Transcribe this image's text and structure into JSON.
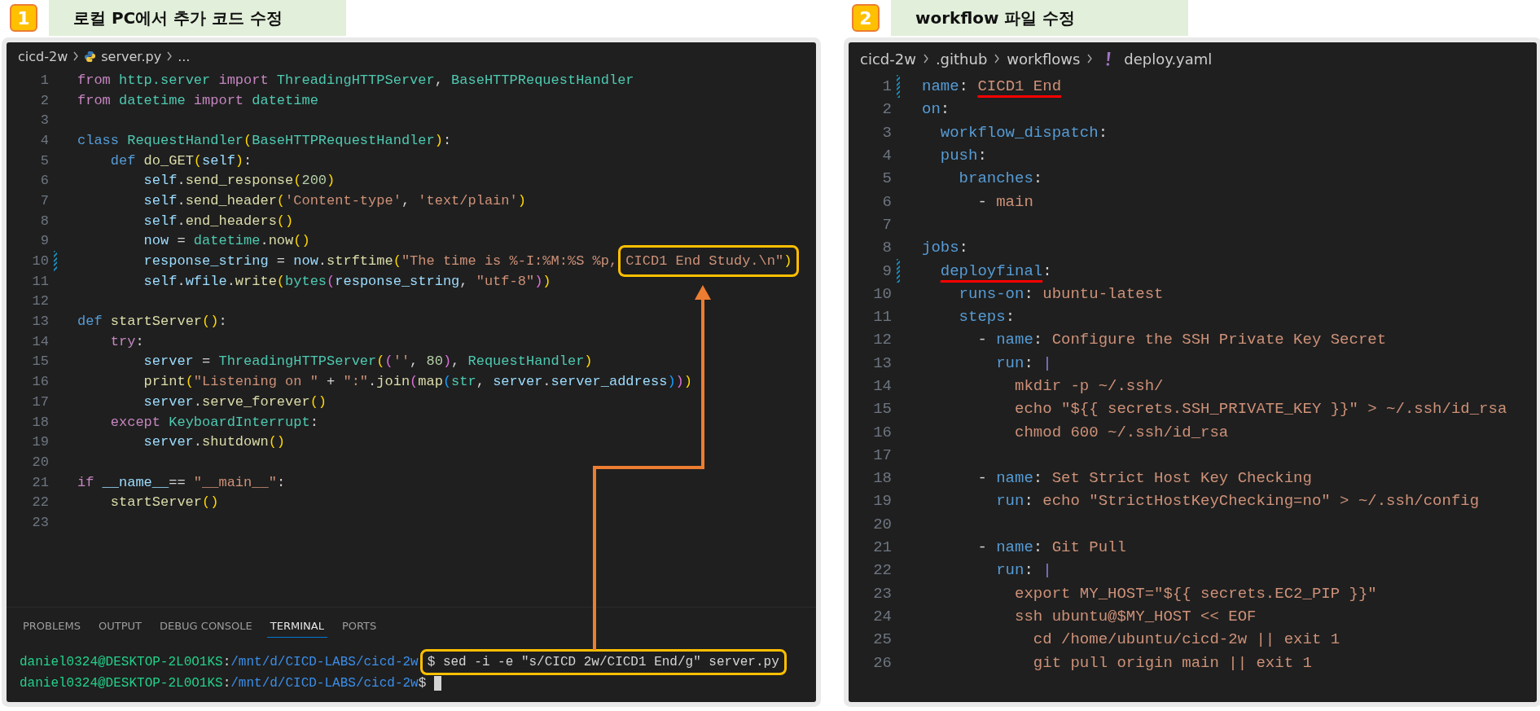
{
  "panels": [
    {
      "kind": "python",
      "step": "1",
      "title": "로컬 PC에서 추가 코드 수정",
      "arrow": true,
      "breadcrumbs": [
        {
          "text": "cicd-2w",
          "kind": "folder"
        },
        {
          "text": "server.py",
          "kind": "python-file"
        },
        {
          "text": "...",
          "kind": "more"
        }
      ],
      "lines": [
        {
          "n": "1",
          "modified": false,
          "tokens": [
            {
              "text": "from",
              "kind": "control"
            },
            {
              "text": " http.server ",
              "kind": "type"
            },
            {
              "text": "import",
              "kind": "control"
            },
            {
              "text": " ThreadingHTTPServer",
              "kind": "type"
            },
            {
              "text": ", ",
              "kind": "plain"
            },
            {
              "text": "BaseHTTPRequestHandler",
              "kind": "type"
            }
          ]
        },
        {
          "n": "2",
          "modified": false,
          "tokens": [
            {
              "text": "from",
              "kind": "control"
            },
            {
              "text": " datetime ",
              "kind": "type"
            },
            {
              "text": "import",
              "kind": "control"
            },
            {
              "text": " datetime",
              "kind": "type"
            }
          ]
        },
        {
          "n": "3",
          "modified": false
        },
        {
          "n": "4",
          "modified": false,
          "tokens": [
            {
              "text": "class",
              "kind": "keyword"
            },
            {
              "text": " RequestHandler",
              "kind": "type"
            },
            {
              "text": "(",
              "kind": "bracket1"
            },
            {
              "text": "BaseHTTPRequestHandler",
              "kind": "type"
            },
            {
              "text": ")",
              "kind": "bracket1"
            },
            {
              "text": ":",
              "kind": "plain"
            }
          ]
        },
        {
          "n": "5",
          "modified": false,
          "tokens": [
            {
              "text": "    def",
              "kind": "keyword"
            },
            {
              "text": " do_GET",
              "kind": "function"
            },
            {
              "text": "(",
              "kind": "bracket1"
            },
            {
              "text": "self",
              "kind": "variable"
            },
            {
              "text": ")",
              "kind": "bracket1"
            },
            {
              "text": ":",
              "kind": "plain"
            }
          ]
        },
        {
          "n": "6",
          "modified": false,
          "tokens": [
            {
              "text": "        self",
              "kind": "variable"
            },
            {
              "text": ".",
              "kind": "plain"
            },
            {
              "text": "send_response",
              "kind": "function"
            },
            {
              "text": "(",
              "kind": "bracket1"
            },
            {
              "text": "200",
              "kind": "number"
            },
            {
              "text": ")",
              "kind": "bracket1"
            }
          ]
        },
        {
          "n": "7",
          "modified": false,
          "tokens": [
            {
              "text": "        self",
              "kind": "variable"
            },
            {
              "text": ".",
              "kind": "plain"
            },
            {
              "text": "send_header",
              "kind": "function"
            },
            {
              "text": "(",
              "kind": "bracket1"
            },
            {
              "text": "'Content-type'",
              "kind": "string"
            },
            {
              "text": ", ",
              "kind": "plain"
            },
            {
              "text": "'text/plain'",
              "kind": "string"
            },
            {
              "text": ")",
              "kind": "bracket1"
            }
          ]
        },
        {
          "n": "8",
          "modified": false,
          "tokens": [
            {
              "text": "        self",
              "kind": "variable"
            },
            {
              "text": ".",
              "kind": "plain"
            },
            {
              "text": "end_headers",
              "kind": "function"
            },
            {
              "text": "()",
              "kind": "bracket1"
            }
          ]
        },
        {
          "n": "9",
          "modified": false,
          "tokens": [
            {
              "text": "        now",
              "kind": "variable"
            },
            {
              "text": " = ",
              "kind": "plain"
            },
            {
              "text": "datetime",
              "kind": "type"
            },
            {
              "text": ".",
              "kind": "plain"
            },
            {
              "text": "now",
              "kind": "function"
            },
            {
              "text": "()",
              "kind": "bracket1"
            }
          ]
        },
        {
          "n": "10",
          "modified": true,
          "tokens": [
            {
              "text": "        response_string",
              "kind": "variable"
            },
            {
              "text": " = ",
              "kind": "plain"
            },
            {
              "text": "now",
              "kind": "variable"
            },
            {
              "text": ".",
              "kind": "plain"
            },
            {
              "text": "strftime",
              "kind": "function"
            },
            {
              "text": "(",
              "kind": "bracket1"
            },
            {
              "text": "\"The time is %-I:%M:%S %p, ",
              "kind": "string"
            },
            {
              "text": "CICD1 End Study.\\n\"",
              "kind": "string",
              "highlighted": true
            },
            {
              "text": ")",
              "kind": "bracket1",
              "highlighted": true
            }
          ]
        },
        {
          "n": "11",
          "modified": false,
          "tokens": [
            {
              "text": "        self",
              "kind": "variable"
            },
            {
              "text": ".",
              "kind": "plain"
            },
            {
              "text": "wfile",
              "kind": "variable"
            },
            {
              "text": ".",
              "kind": "plain"
            },
            {
              "text": "write",
              "kind": "function"
            },
            {
              "text": "(",
              "kind": "bracket1"
            },
            {
              "text": "bytes",
              "kind": "type"
            },
            {
              "text": "(",
              "kind": "bracket2"
            },
            {
              "text": "response_string",
              "kind": "variable"
            },
            {
              "text": ", ",
              "kind": "plain"
            },
            {
              "text": "\"utf-8\"",
              "kind": "string"
            },
            {
              "text": ")",
              "kind": "bracket2"
            },
            {
              "text": ")",
              "kind": "bracket1"
            }
          ]
        },
        {
          "n": "12",
          "modified": false
        },
        {
          "n": "13",
          "modified": false,
          "tokens": [
            {
              "text": "def",
              "kind": "keyword"
            },
            {
              "text": " startServer",
              "kind": "function"
            },
            {
              "text": "()",
              "kind": "bracket1"
            },
            {
              "text": ":",
              "kind": "plain"
            }
          ]
        },
        {
          "n": "14",
          "modified": false,
          "tokens": [
            {
              "text": "    try",
              "kind": "control"
            },
            {
              "text": ":",
              "kind": "plain"
            }
          ]
        },
        {
          "n": "15",
          "modified": false,
          "tokens": [
            {
              "text": "        server",
              "kind": "variable"
            },
            {
              "text": " = ",
              "kind": "plain"
            },
            {
              "text": "ThreadingHTTPServer",
              "kind": "type"
            },
            {
              "text": "(",
              "kind": "bracket1"
            },
            {
              "text": "(",
              "kind": "bracket2"
            },
            {
              "text": "''",
              "kind": "string"
            },
            {
              "text": ", ",
              "kind": "plain"
            },
            {
              "text": "80",
              "kind": "number"
            },
            {
              "text": ")",
              "kind": "bracket2"
            },
            {
              "text": ", ",
              "kind": "plain"
            },
            {
              "text": "RequestHandler",
              "kind": "type"
            },
            {
              "text": ")",
              "kind": "bracket1"
            }
          ]
        },
        {
          "n": "16",
          "modified": false,
          "tokens": [
            {
              "text": "        print",
              "kind": "function"
            },
            {
              "text": "(",
              "kind": "bracket1"
            },
            {
              "text": "\"Listening on \"",
              "kind": "string"
            },
            {
              "text": " + ",
              "kind": "plain"
            },
            {
              "text": "\":\"",
              "kind": "string"
            },
            {
              "text": ".",
              "kind": "plain"
            },
            {
              "text": "join",
              "kind": "function"
            },
            {
              "text": "(",
              "kind": "bracket2"
            },
            {
              "text": "map",
              "kind": "function"
            },
            {
              "text": "(",
              "kind": "bracket3"
            },
            {
              "text": "str",
              "kind": "type"
            },
            {
              "text": ", ",
              "kind": "plain"
            },
            {
              "text": "server",
              "kind": "variable"
            },
            {
              "text": ".",
              "kind": "plain"
            },
            {
              "text": "server_address",
              "kind": "variable"
            },
            {
              "text": ")",
              "kind": "bracket3"
            },
            {
              "text": ")",
              "kind": "bracket2"
            },
            {
              "text": ")",
              "kind": "bracket1"
            }
          ]
        },
        {
          "n": "17",
          "modified": false,
          "tokens": [
            {
              "text": "        server",
              "kind": "variable"
            },
            {
              "text": ".",
              "kind": "plain"
            },
            {
              "text": "serve_forever",
              "kind": "function"
            },
            {
              "text": "()",
              "kind": "bracket1"
            }
          ]
        },
        {
          "n": "18",
          "modified": false,
          "tokens": [
            {
              "text": "    except",
              "kind": "control"
            },
            {
              "text": " KeyboardInterrupt",
              "kind": "type"
            },
            {
              "text": ":",
              "kind": "plain"
            }
          ]
        },
        {
          "n": "19",
          "modified": false,
          "tokens": [
            {
              "text": "        server",
              "kind": "variable"
            },
            {
              "text": ".",
              "kind": "plain"
            },
            {
              "text": "shutdown",
              "kind": "function"
            },
            {
              "text": "()",
              "kind": "bracket1"
            }
          ]
        },
        {
          "n": "20",
          "modified": false
        },
        {
          "n": "21",
          "modified": false,
          "tokens": [
            {
              "text": "if",
              "kind": "control"
            },
            {
              "text": " __name__",
              "kind": "variable"
            },
            {
              "text": "== ",
              "kind": "plain"
            },
            {
              "text": "\"__main__\"",
              "kind": "string"
            },
            {
              "text": ":",
              "kind": "plain"
            }
          ]
        },
        {
          "n": "22",
          "modified": false,
          "tokens": [
            {
              "text": "    startServer",
              "kind": "function"
            },
            {
              "text": "()",
              "kind": "bracket1"
            }
          ]
        },
        {
          "n": "23",
          "modified": false
        }
      ],
      "terminal": {
        "tabs": [
          {
            "label": "PROBLEMS",
            "selected": false
          },
          {
            "label": "OUTPUT",
            "selected": false
          },
          {
            "label": "DEBUG CONSOLE",
            "selected": false
          },
          {
            "label": "TERMINAL",
            "selected": true
          },
          {
            "label": "PORTS",
            "selected": false
          }
        ],
        "lines": [
          [
            {
              "text": "daniel0324@DESKTOP-2L0O1KS",
              "kind": "user"
            },
            {
              "text": ":",
              "kind": "plain"
            },
            {
              "text": "/mnt/d/CICD-LABS/cicd-2w",
              "kind": "path"
            },
            {
              "text": "$ sed -i -e \"s/CICD 2w/CICD1 End/g\" server.py",
              "kind": "plain",
              "highlighted": true
            }
          ],
          [
            {
              "text": "daniel0324@DESKTOP-2L0O1KS",
              "kind": "user"
            },
            {
              "text": ":",
              "kind": "plain"
            },
            {
              "text": "/mnt/d/CICD-LABS/cicd-2w",
              "kind": "path"
            },
            {
              "text": "$ ",
              "kind": "plain"
            },
            {
              "kind": "cursor"
            }
          ]
        ]
      }
    },
    {
      "kind": "yaml",
      "step": "2",
      "title": "workflow 파일 수정",
      "arrow": false,
      "breadcrumbs": [
        {
          "text": "cicd-2w",
          "kind": "folder"
        },
        {
          "text": ".github",
          "kind": "folder"
        },
        {
          "text": "workflows",
          "kind": "folder"
        },
        {
          "text": "deploy.yaml",
          "kind": "yaml-file"
        }
      ],
      "lines": [
        {
          "n": "1",
          "modified": true,
          "tokens": [
            {
              "text": "name",
              "kind": "key"
            },
            {
              "text": ": ",
              "kind": "plain"
            },
            {
              "text": "CICD1 End",
              "kind": "value",
              "underlined": true
            }
          ]
        },
        {
          "n": "2",
          "modified": false,
          "tokens": [
            {
              "text": "on",
              "kind": "key"
            },
            {
              "text": ":",
              "kind": "plain"
            }
          ]
        },
        {
          "n": "3",
          "modified": false,
          "tokens": [
            {
              "text": "  workflow_dispatch",
              "kind": "key"
            },
            {
              "text": ":",
              "kind": "plain"
            }
          ]
        },
        {
          "n": "4",
          "modified": false,
          "tokens": [
            {
              "text": "  push",
              "kind": "key"
            },
            {
              "text": ":",
              "kind": "plain"
            }
          ]
        },
        {
          "n": "5",
          "modified": false,
          "tokens": [
            {
              "text": "    branches",
              "kind": "key"
            },
            {
              "text": ":",
              "kind": "plain"
            }
          ]
        },
        {
          "n": "6",
          "modified": false,
          "tokens": [
            {
              "text": "      - ",
              "kind": "plain"
            },
            {
              "text": "main",
              "kind": "value"
            }
          ]
        },
        {
          "n": "7",
          "modified": false
        },
        {
          "n": "8",
          "modified": false,
          "tokens": [
            {
              "text": "jobs",
              "kind": "key"
            },
            {
              "text": ":",
              "kind": "plain"
            }
          ]
        },
        {
          "n": "9",
          "modified": true,
          "tokens": [
            {
              "text": "  deployfinal",
              "kind": "key",
              "underlined": true
            },
            {
              "text": ":",
              "kind": "plain"
            }
          ]
        },
        {
          "n": "10",
          "modified": false,
          "tokens": [
            {
              "text": "    runs-on",
              "kind": "key"
            },
            {
              "text": ": ",
              "kind": "plain"
            },
            {
              "text": "ubuntu-latest",
              "kind": "value"
            }
          ]
        },
        {
          "n": "11",
          "modified": false,
          "tokens": [
            {
              "text": "    steps",
              "kind": "key"
            },
            {
              "text": ":",
              "kind": "plain"
            }
          ]
        },
        {
          "n": "12",
          "modified": false,
          "tokens": [
            {
              "text": "      - ",
              "kind": "plain"
            },
            {
              "text": "name",
              "kind": "key"
            },
            {
              "text": ": ",
              "kind": "plain"
            },
            {
              "text": "Configure the SSH Private Key Secret",
              "kind": "value"
            }
          ]
        },
        {
          "n": "13",
          "modified": false,
          "tokens": [
            {
              "text": "        run",
              "kind": "key"
            },
            {
              "text": ": ",
              "kind": "plain"
            },
            {
              "text": "|",
              "kind": "operator"
            }
          ]
        },
        {
          "n": "14",
          "modified": false,
          "tokens": [
            {
              "text": "          mkdir -p ~/.ssh/",
              "kind": "value"
            }
          ]
        },
        {
          "n": "15",
          "modified": false,
          "tokens": [
            {
              "text": "          echo \"${{ secrets.SSH_PRIVATE_KEY }}\" > ~/.ssh/id_rsa",
              "kind": "value"
            }
          ]
        },
        {
          "n": "16",
          "modified": false,
          "tokens": [
            {
              "text": "          chmod 600 ~/.ssh/id_rsa",
              "kind": "value"
            }
          ]
        },
        {
          "n": "17",
          "modified": false
        },
        {
          "n": "18",
          "modified": false,
          "tokens": [
            {
              "text": "      - ",
              "kind": "plain"
            },
            {
              "text": "name",
              "kind": "key"
            },
            {
              "text": ": ",
              "kind": "plain"
            },
            {
              "text": "Set Strict Host Key Checking",
              "kind": "value"
            }
          ]
        },
        {
          "n": "19",
          "modified": false,
          "tokens": [
            {
              "text": "        run",
              "kind": "key"
            },
            {
              "text": ": ",
              "kind": "plain"
            },
            {
              "text": "echo \"StrictHostKeyChecking=no\" > ~/.ssh/config",
              "kind": "value"
            }
          ]
        },
        {
          "n": "20",
          "modified": false
        },
        {
          "n": "21",
          "modified": false,
          "tokens": [
            {
              "text": "      - ",
              "kind": "plain"
            },
            {
              "text": "name",
              "kind": "key"
            },
            {
              "text": ": ",
              "kind": "plain"
            },
            {
              "text": "Git Pull",
              "kind": "value"
            }
          ]
        },
        {
          "n": "22",
          "modified": false,
          "tokens": [
            {
              "text": "        run",
              "kind": "key"
            },
            {
              "text": ": ",
              "kind": "plain"
            },
            {
              "text": "|",
              "kind": "operator"
            }
          ]
        },
        {
          "n": "23",
          "modified": false,
          "tokens": [
            {
              "text": "          export MY_HOST=\"${{ secrets.EC2_PIP }}\"",
              "kind": "value"
            }
          ]
        },
        {
          "n": "24",
          "modified": false,
          "tokens": [
            {
              "text": "          ssh ubuntu@$MY_HOST << EOF",
              "kind": "value"
            }
          ]
        },
        {
          "n": "25",
          "modified": false,
          "tokens": [
            {
              "text": "            cd /home/ubuntu/cicd-2w || exit 1",
              "kind": "value"
            }
          ]
        },
        {
          "n": "26",
          "modified": false,
          "tokens": [
            {
              "text": "            git pull origin main || exit 1",
              "kind": "value"
            }
          ]
        }
      ]
    }
  ]
}
